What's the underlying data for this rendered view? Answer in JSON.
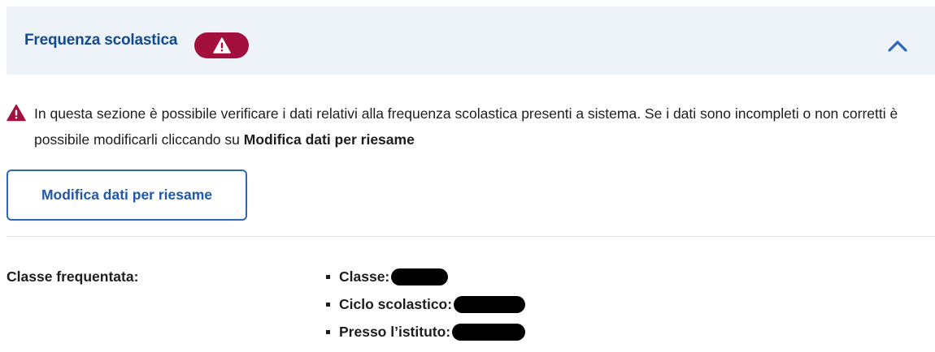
{
  "header": {
    "title": "Frequenza scolastica",
    "badge_icon": "warning-triangle-icon",
    "badge_color": "#a3103e",
    "toggle_icon": "chevron-up-icon",
    "background_color": "#eef3f9",
    "title_color": "#124a8f"
  },
  "notice": {
    "icon": "warning-triangle-icon",
    "text_before": "In questa sezione è possibile verificare i dati relativi alla frequenza scolastica presenti a sistema. Se i dati sono incompleti o non corretti è possibile modificarli cliccando su ",
    "text_bold": "Modifica dati per riesame"
  },
  "edit_button": {
    "label": "Modifica dati per riesame",
    "color": "#2f67b5"
  },
  "attendance": {
    "label": "Classe frequentata:",
    "items": [
      {
        "label": "Classe:"
      },
      {
        "label": "Ciclo scolastico:"
      },
      {
        "label": "Presso l’istituto:"
      }
    ]
  }
}
